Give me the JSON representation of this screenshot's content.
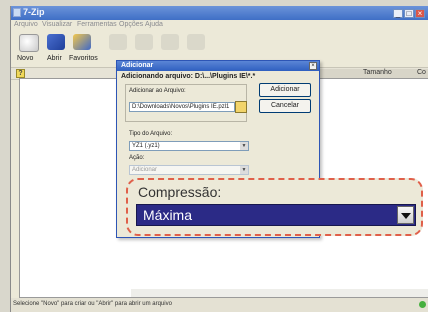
{
  "window": {
    "title": "7-Zip"
  },
  "menu": [
    "Arquivo",
    "Visualizar",
    "Ferramentas",
    "Opções",
    "Ajuda"
  ],
  "toolbar": [
    {
      "label": "Novo",
      "icon": "new-icon"
    },
    {
      "label": "Abrir",
      "icon": "open-icon"
    },
    {
      "label": "Favoritos",
      "icon": "favorites-icon"
    }
  ],
  "columns": [
    "Tamanho",
    "Co"
  ],
  "status": {
    "text": "Selecione \"Novo\" para criar ou \"Abrir\" para abrir um arquivo"
  },
  "dialog": {
    "title": "Adicionar",
    "heading": "Adicionando arquivo: D:\\...\\Plugins IE\\*.*",
    "path_label": "Adicionar ao Arquivo:",
    "path_value": "D:\\Downloads\\Novos\\Plugins IE.pzl1",
    "add_button": "Adicionar",
    "cancel_button": "Cancelar",
    "type_label": "Tipo do Arquivo:",
    "type_value": "YZ1 (.yz1)",
    "action_label": "Ação:",
    "action_value": "Adicionar"
  },
  "zoom": {
    "label": "Compressão:",
    "value": "Máxima"
  },
  "colors": {
    "title_bar": "#3f6fc6",
    "selection": "#2b2a86",
    "callout_border": "#e0604a"
  }
}
